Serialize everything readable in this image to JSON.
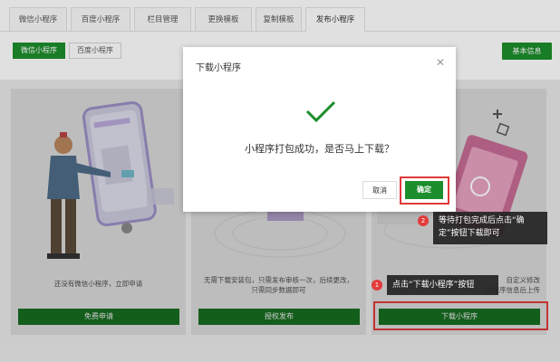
{
  "tabs": [
    "微信小程序",
    "百度小程序",
    "栏目管理",
    "更换模板",
    "复制模板",
    "发布小程序"
  ],
  "active_tab": 5,
  "sub_tabs": [
    "微信小程序",
    "百度小程序"
  ],
  "info_button": "基本信息",
  "cards": [
    {
      "text_lines": [
        "还没有微信小程序，立即申请"
      ],
      "button": "免费申请"
    },
    {
      "text_lines": [
        "无需下载安装包，只需发布审核一次，后续更改，",
        "只需同步数据即可"
      ],
      "button": "授权发布"
    },
    {
      "text_lines": [
        "自定义修改",
        "小程序信息后上传"
      ],
      "button": "下载小程序"
    }
  ],
  "dialog": {
    "title": "下载小程序",
    "message": "小程序打包成功，是否马上下载？",
    "cancel": "取消",
    "ok": "确定"
  },
  "callouts": [
    {
      "number": "1",
      "text": "点击“下载小程序”按钮"
    },
    {
      "number": "2",
      "text_line1": "等待打包完成后点击“确",
      "text_line2": "定”按钮下载即可"
    }
  ],
  "colors": {
    "brand_green": "#1d8e2c",
    "highlight_red": "#e0393b"
  }
}
